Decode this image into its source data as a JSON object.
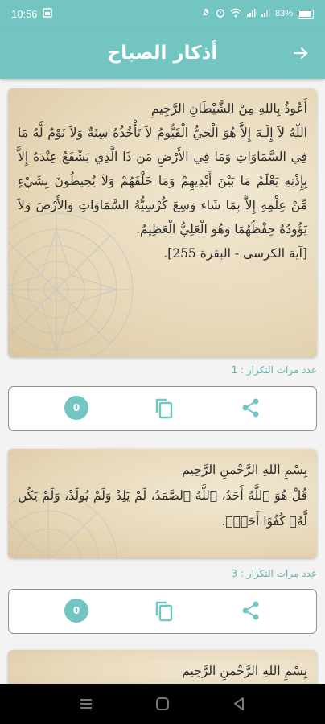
{
  "status_bar": {
    "time": "10:56",
    "left_icons": [
      "sim-icon"
    ],
    "right_icons": [
      "silent-icon",
      "alarm-icon",
      "wifi-icon",
      "signal-icon",
      "signal-icon"
    ],
    "battery": "83%"
  },
  "app_bar": {
    "title": "أذكار الصباح",
    "back_icon": "arrow-right-icon",
    "color": "#72c5c1"
  },
  "cards": [
    {
      "lines": [
        "أَعُوذُ بِاللهِ مِنْ الشَّيْطَانِ الرَّجِيمِ",
        "اللّهُ لاَ إِلَـهَ إِلاَّ هُوَ الْحَيُّ الْقَيُّومُ لاَ تَأْخُذُهُ سِنَةٌ وَلاَ نَوْمٌ لَّهُ مَا فِي السَّمَاوَاتِ وَمَا فِي الأَرْضِ مَن ذَا الَّذِي يَشْفَعُ عِنْدَهُ إِلاَّ بِإِذْنِهِ يَعْلَمُ مَا بَيْنَ أَيْدِيهِمْ وَمَا خَلْفَهُمْ وَلاَ يُحِيطُونَ بِشَيْءٍ مِّنْ عِلْمِهِ إِلاَّ بِمَا شَاء وَسِعَ كُرْسِيُّهُ السَّمَاوَاتِ وَالأَرْضَ وَلاَ يَؤُودُهُ حِفْظُهُمَا وَهُوَ الْعَلِيُّ الْعَظِيمُ.",
        "[آية الكرسى - البقرة 255]."
      ],
      "repeat_label": "عدد مرات التكرار : 1",
      "counter": "0"
    },
    {
      "lines": [
        "بِسْمِ اللهِ الرَّحْمنِ الرَّحِيم",
        "قُلْ هُوَ ٱللَّهُ أَحَدٌ، ٱللَّهُ ٱلصَّمَدُ، لَمْ يَلِدْ وَلَمْ يُولَدْ، وَلَمْ يَكُن لَّهُۥ كُفُوًا أَحَدٌۢ."
      ],
      "repeat_label": "عدد مرات التكرار : 3",
      "counter": "0"
    },
    {
      "lines": [
        "بِسْمِ اللهِ الرَّحْمنِ الرَّحِيم"
      ]
    }
  ],
  "action_icons": {
    "copy": "copy-icon",
    "share": "share-icon"
  },
  "nav_bar": [
    "menu-icon",
    "home-icon",
    "back-icon"
  ]
}
